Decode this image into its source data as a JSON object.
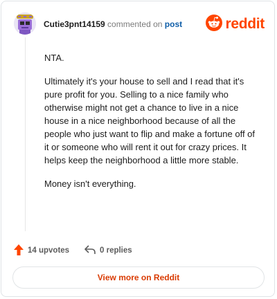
{
  "header": {
    "username": "Cutie3pnt14159",
    "action_text": "commented on",
    "target_link": "post",
    "brand": "reddit"
  },
  "comment": {
    "paragraphs": [
      "NTA.",
      "Ultimately it's your house to sell and I read that it's pure profit for you. Selling to a nice family who otherwise might not get a chance to live in a nice house in a nice neighborhood because of all the people who just want to flip and make a fortune off of it or someone who will rent it out for crazy prices. It helps keep the neighborhood a little more stable.",
      "Money isn't everything."
    ]
  },
  "actions": {
    "upvotes": "14 upvotes",
    "replies": "0 replies"
  },
  "footer": {
    "view_more": "View more on Reddit"
  },
  "colors": {
    "brand": "#ff4500",
    "link": "#0f5ea8",
    "view_more": "#d93a00"
  },
  "icons": [
    "avatar",
    "reddit-logo-icon",
    "upvote-arrow-icon",
    "reply-icon"
  ]
}
